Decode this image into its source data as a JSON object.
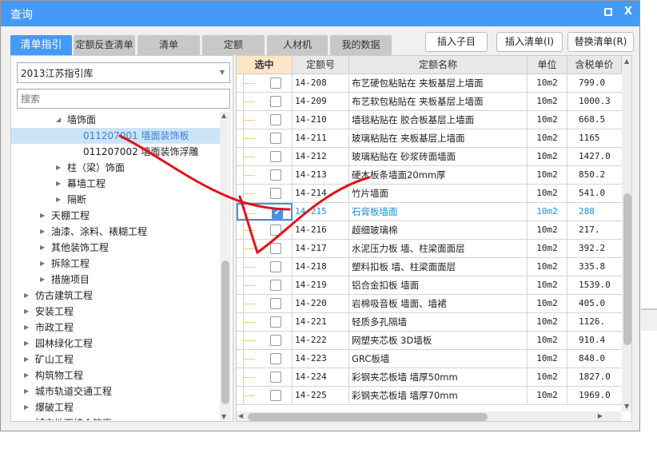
{
  "window": {
    "title": "查询",
    "maximize_icon": "maximize-icon",
    "close_label": "X"
  },
  "tabs": [
    "清单指引",
    "定额反查清单",
    "清单",
    "定额",
    "人材机",
    "我的数据"
  ],
  "buttons": {
    "insert_child": "插入子目",
    "insert_list": "插入清单(I)",
    "replace_list": "替换清单(R)"
  },
  "left": {
    "library": "2013江苏指引库",
    "search_placeholder": "搜索",
    "tree": [
      {
        "label": "墙饰面",
        "level": 3,
        "expanded": true
      },
      {
        "label": "011207001  墙面装饰板",
        "level": 4,
        "selected": true
      },
      {
        "label": "011207002  墙面装饰浮雕",
        "level": 4
      },
      {
        "label": "柱（梁）饰面",
        "level": 3
      },
      {
        "label": "幕墙工程",
        "level": 3
      },
      {
        "label": "隔断",
        "level": 3
      },
      {
        "label": "天棚工程",
        "level": 2
      },
      {
        "label": "油漆、涂料、裱糊工程",
        "level": 2
      },
      {
        "label": "其他装饰工程",
        "level": 2
      },
      {
        "label": "拆除工程",
        "level": 2
      },
      {
        "label": "措施项目",
        "level": 2
      },
      {
        "label": "仿古建筑工程",
        "level": 1
      },
      {
        "label": "安装工程",
        "level": 1
      },
      {
        "label": "市政工程",
        "level": 1
      },
      {
        "label": "园林绿化工程",
        "level": 1
      },
      {
        "label": "矿山工程",
        "level": 1
      },
      {
        "label": "构筑物工程",
        "level": 1
      },
      {
        "label": "城市轨道交通工程",
        "level": 1
      },
      {
        "label": "爆破工程",
        "level": 1
      },
      {
        "label": "城市地下综合管廊",
        "level": 1
      }
    ]
  },
  "grid": {
    "headers": [
      "选中",
      "定额号",
      "定额名称",
      "单位",
      "含税单价"
    ],
    "rows": [
      {
        "code": "14-208",
        "name": "布艺硬包粘贴在 夹板基层上墙面",
        "unit": "10m2",
        "price": "799.0",
        "checked": false
      },
      {
        "code": "14-209",
        "name": "布艺软包粘贴在 夹板基层上墙面",
        "unit": "10m2",
        "price": "1000.3",
        "checked": false
      },
      {
        "code": "14-210",
        "name": "墙毯粘贴在 胶合板基层上墙面",
        "unit": "10m2",
        "price": "668.5",
        "checked": false
      },
      {
        "code": "14-211",
        "name": "玻璃粘贴在 夹板基层上墙面",
        "unit": "10m2",
        "price": "1165",
        "checked": false
      },
      {
        "code": "14-212",
        "name": "玻璃粘贴在 砂浆砖面墙面",
        "unit": "10m2",
        "price": "1427.0",
        "checked": false
      },
      {
        "code": "14-213",
        "name": "硬木板条墙面20mm厚",
        "unit": "10m2",
        "price": "850.2",
        "checked": false
      },
      {
        "code": "14-214",
        "name": "竹片墙面",
        "unit": "10m2",
        "price": "541.0",
        "checked": false
      },
      {
        "code": "14-215",
        "name": "石膏板墙面",
        "unit": "10m2",
        "price": "288",
        "checked": true
      },
      {
        "code": "14-216",
        "name": "超细玻璃棉",
        "unit": "10m2",
        "price": "217.",
        "checked": false
      },
      {
        "code": "14-217",
        "name": "水泥压力板 墙、柱梁面面层",
        "unit": "10m2",
        "price": "392.2",
        "checked": false
      },
      {
        "code": "14-218",
        "name": "塑料扣板 墙、柱梁面面层",
        "unit": "10m2",
        "price": "335.8",
        "checked": false
      },
      {
        "code": "14-219",
        "name": "铝合金扣板 墙面",
        "unit": "10m2",
        "price": "1539.0",
        "checked": false
      },
      {
        "code": "14-220",
        "name": "岩棉吸音板 墙面、墙裙",
        "unit": "10m2",
        "price": "405.0",
        "checked": false
      },
      {
        "code": "14-221",
        "name": "轻质多孔隔墙",
        "unit": "10m2",
        "price": "1126.",
        "checked": false
      },
      {
        "code": "14-222",
        "name": "网塑夹芯板 3D墙板",
        "unit": "10m2",
        "price": "910.4",
        "checked": false
      },
      {
        "code": "14-223",
        "name": "GRC板墙",
        "unit": "10m2",
        "price": "848.0",
        "checked": false
      },
      {
        "code": "14-224",
        "name": "彩钢夹芯板墙 墙厚50mm",
        "unit": "10m2",
        "price": "1827.0",
        "checked": false
      },
      {
        "code": "14-225",
        "name": "彩钢夹芯板墙 墙厚70mm",
        "unit": "10m2",
        "price": "1969.0",
        "checked": false
      }
    ]
  },
  "colors": {
    "accent": "#4599f7",
    "selected_text": "#1e8fd8",
    "annotation": "#e0141a"
  }
}
